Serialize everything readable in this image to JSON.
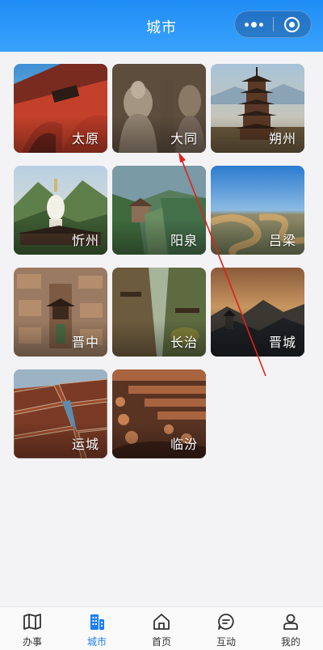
{
  "header": {
    "title": "城市"
  },
  "cities": [
    {
      "name": "太原",
      "id": "taiyuan"
    },
    {
      "name": "大同",
      "id": "datong"
    },
    {
      "name": "朔州",
      "id": "shuozhou"
    },
    {
      "name": "忻州",
      "id": "xinzhou"
    },
    {
      "name": "阳泉",
      "id": "yangquan"
    },
    {
      "name": "吕梁",
      "id": "lvliang"
    },
    {
      "name": "晋中",
      "id": "jinzhong"
    },
    {
      "name": "长治",
      "id": "changzhi"
    },
    {
      "name": "晋城",
      "id": "jincheng"
    },
    {
      "name": "运城",
      "id": "yuncheng"
    },
    {
      "name": "临汾",
      "id": "linfen"
    }
  ],
  "tabbar": {
    "items": [
      {
        "label": "办事",
        "icon": "map-icon"
      },
      {
        "label": "城市",
        "icon": "city-buildings-icon"
      },
      {
        "label": "首页",
        "icon": "home-icon"
      },
      {
        "label": "互动",
        "icon": "chat-icon"
      },
      {
        "label": "我的",
        "icon": "user-icon"
      }
    ],
    "active_label": "城市",
    "accent_color": "#1a7ff2"
  }
}
